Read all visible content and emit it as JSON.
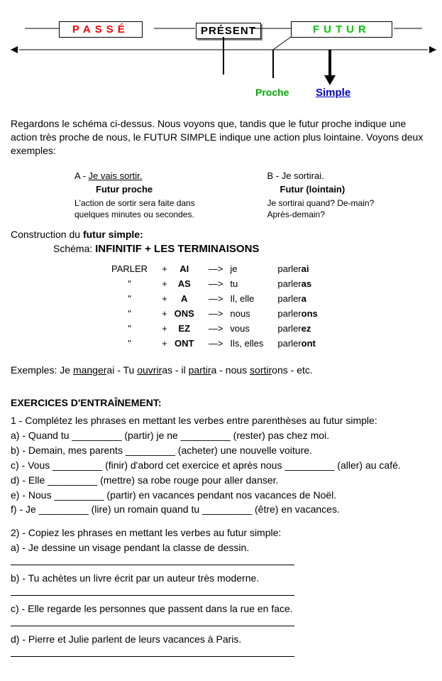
{
  "diagram": {
    "passe": "PASSÉ",
    "present": "PRÉSENT",
    "futur": "FUTUR",
    "proche": "Proche",
    "simple": "Simple"
  },
  "intro": " Regardons le schéma ci-dessus. Nous voyons que, tandis que le futur proche indique une action très proche de nous, le FUTUR SIMPLE indique une action plus lointaine. Voyons deux exemples:",
  "exA": {
    "prefix": "A -  ",
    "sentence": "Je vais sortir.",
    "label": "Futur proche",
    "desc": "L'action de sortir sera faite dans quelques minutes ou secondes."
  },
  "exB": {
    "prefix": "B -   ",
    "sentence": "Je sortirai.",
    "label": "Futur (lointain)",
    "desc": "Je sortirai quand? De-main? Après-demain?"
  },
  "constr_label": "Construction du ",
  "constr_bold": "futur simple:",
  "schema_label": "Schéma:    ",
  "schema_bold": "INFINITIF + LES TERMINAISONS",
  "conj": {
    "verb": "PARLER",
    "ditto": "\"",
    "plus": "+",
    "arrow": "—>",
    "rows": [
      {
        "end": "AI",
        "pron": "je",
        "base": "parler",
        "suf": "ai"
      },
      {
        "end": "AS",
        "pron": "tu",
        "base": "parler",
        "suf": "as"
      },
      {
        "end": "A",
        "pron": "Il, elle",
        "base": "parler",
        "suf": "a"
      },
      {
        "end": "ONS",
        "pron": "nous",
        "base": "parler",
        "suf": "ons"
      },
      {
        "end": "EZ",
        "pron": "vous",
        "base": "parler",
        "suf": "ez"
      },
      {
        "end": "ONT",
        "pron": "Ils, elles",
        "base": "parler",
        "suf": "ont"
      }
    ]
  },
  "exemples": {
    "label": "Exemples:  ",
    "parts": [
      {
        "pre": "Je ",
        "u": "manger",
        "post": "ai"
      },
      {
        "sep": "   -   ",
        "pre": "Tu ",
        "u": "ouvrir",
        "post": "as"
      },
      {
        "sep": "   -   ",
        "pre": "il ",
        "u": "partir",
        "post": "a"
      },
      {
        "sep": "   -   ",
        "pre": "nous ",
        "u": "sortir",
        "post": "ons"
      },
      {
        "sep": "   -   ",
        "pre": "",
        "u": "",
        "post": "etc."
      }
    ]
  },
  "exercices": {
    "title": "EXERCICES D'ENTRAÎNEMENT:",
    "ex1_intro": "1 - Complétez les phrases en mettant les verbes entre parenthèses au futur simple:",
    "ex1": [
      "a) - Quand tu _________ (partir) je ne _________ (rester) pas chez moi.",
      "b) - Demain, mes parents _________ (acheter) une nouvelle voiture.",
      "c) - Vous _________ (finir) d'abord cet exercice et après nous _________ (aller) au café.",
      "d) - Elle _________ (mettre) sa robe rouge pour aller danser.",
      "e) - Nous _________ (partir) en vacances pendant nos vacances de Noël.",
      "f) - Je _________ (lire) un romain quand tu _________ (être) en vacances."
    ],
    "ex2_intro": "2) - Copiez les phrases en mettant les verbes au futur simple:",
    "ex2": [
      "a) - Je dessine un visage pendant la classe de dessin.",
      "b) - Tu achètes un livre écrit par un auteur très moderne.",
      "c) - Elle regarde les personnes que passent dans la rue en face.",
      "d) - Pierre et Julie parlent de leurs vacances à Paris."
    ]
  }
}
